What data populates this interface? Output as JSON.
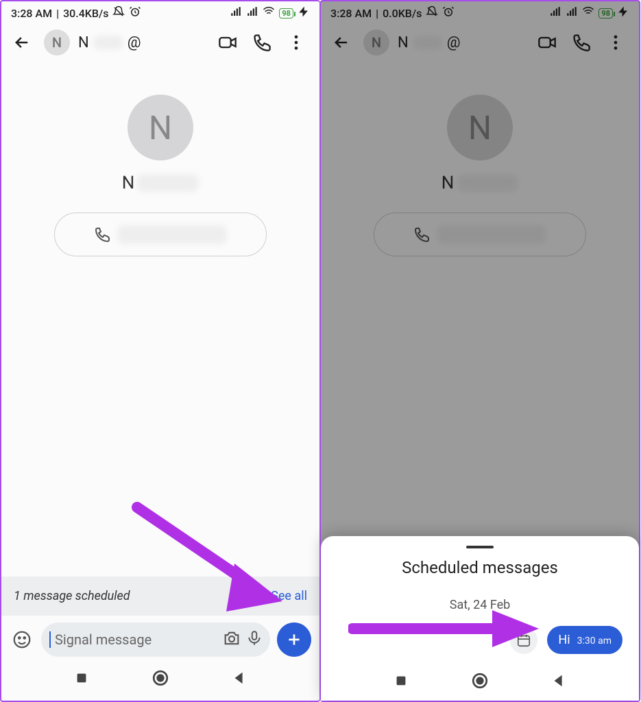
{
  "left": {
    "status": {
      "time": "3:28 AM",
      "net": "30.4KB/s",
      "battery": "98"
    },
    "header": {
      "avatar_letter": "N",
      "name_initial": "N",
      "at": "@"
    },
    "profile": {
      "avatar_letter": "N",
      "name_initial": "N"
    },
    "scheduled": {
      "text": "1 message scheduled",
      "see_all": "See all"
    },
    "composer": {
      "placeholder": "Signal message"
    }
  },
  "right": {
    "status": {
      "time": "3:28 AM",
      "net": "0.0KB/s",
      "battery": "98"
    },
    "header": {
      "avatar_letter": "N",
      "name_initial": "N",
      "at": "@"
    },
    "profile": {
      "avatar_letter": "N",
      "name_initial": "N"
    },
    "sheet": {
      "title": "Scheduled messages",
      "date": "Sat, 24 Feb",
      "message_text": "Hi",
      "message_time": "3:30 am"
    }
  }
}
